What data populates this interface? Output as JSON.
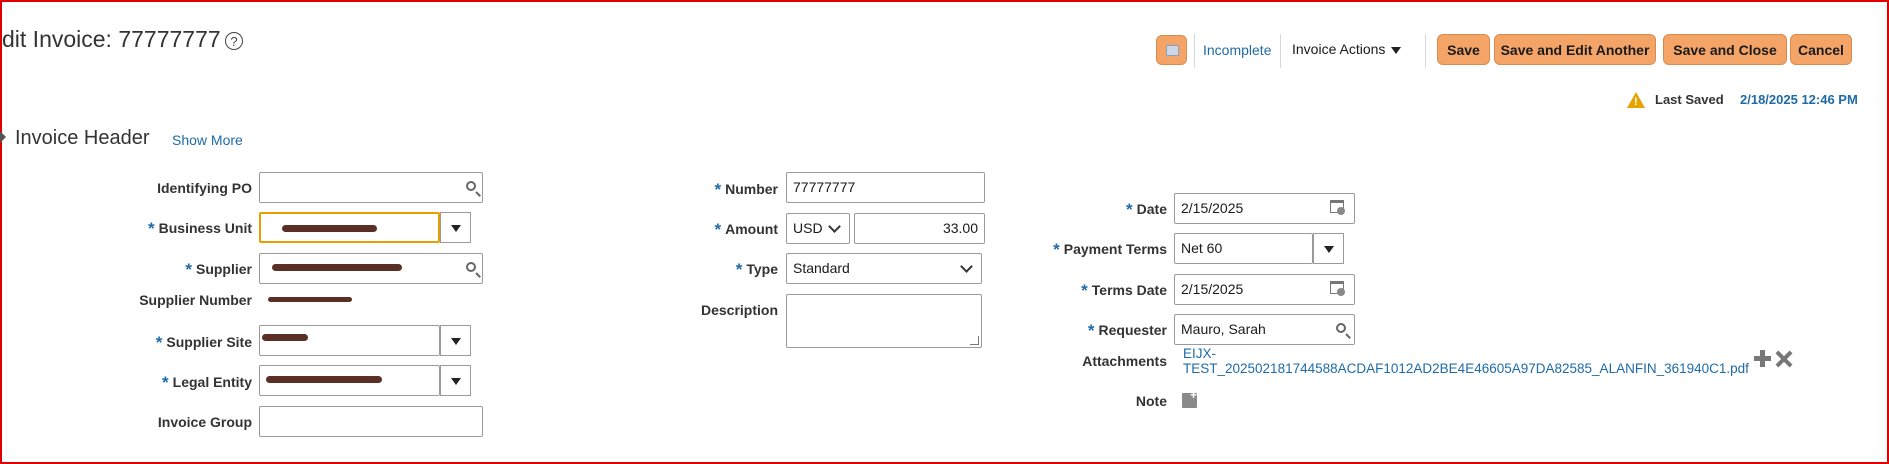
{
  "header": {
    "title": "dit Invoice: 77777777",
    "help_glyph": "?"
  },
  "toolbar": {
    "status_link": "Incomplete",
    "invoice_actions_label": "Invoice Actions",
    "save_label": "Save",
    "save_edit_another_label": "Save and Edit Another",
    "save_close_label": "Save and Close",
    "cancel_label": "Cancel",
    "accent_color": "#f4a467"
  },
  "last_saved": {
    "label": "Last Saved",
    "value": "2/18/2025 12:46 PM",
    "warn_glyph": "!"
  },
  "section": {
    "title": "Invoice Header",
    "show_more": "Show More"
  },
  "left_col": {
    "identifying_po": {
      "label": "Identifying PO",
      "value": ""
    },
    "business_unit": {
      "label": "Business Unit",
      "value": ""
    },
    "supplier": {
      "label": "Supplier",
      "value": ""
    },
    "supplier_number": {
      "label": "Supplier Number",
      "value": ""
    },
    "supplier_site": {
      "label": "Supplier Site",
      "value": ""
    },
    "legal_entity": {
      "label": "Legal Entity",
      "value": ""
    },
    "invoice_group": {
      "label": "Invoice Group",
      "value": ""
    }
  },
  "mid_col": {
    "number": {
      "label": "Number",
      "value": "77777777"
    },
    "amount": {
      "label": "Amount",
      "currency": "USD",
      "value": "33.00"
    },
    "type": {
      "label": "Type",
      "value": "Standard"
    },
    "description": {
      "label": "Description",
      "value": ""
    }
  },
  "right_col": {
    "date": {
      "label": "Date",
      "value": "2/15/2025"
    },
    "payment_terms": {
      "label": "Payment Terms",
      "value": "Net 60"
    },
    "terms_date": {
      "label": "Terms Date",
      "value": "2/15/2025"
    },
    "requester": {
      "label": "Requester",
      "value": "Mauro, Sarah"
    },
    "attachments": {
      "label": "Attachments",
      "line1": "EIJX-",
      "line2": "TEST_202502181744588ACDAF1012AD2BE4E46605A97DA82585_ALANFIN_361940C1.pdf"
    },
    "note": {
      "label": "Note"
    }
  },
  "required_mark": "*"
}
